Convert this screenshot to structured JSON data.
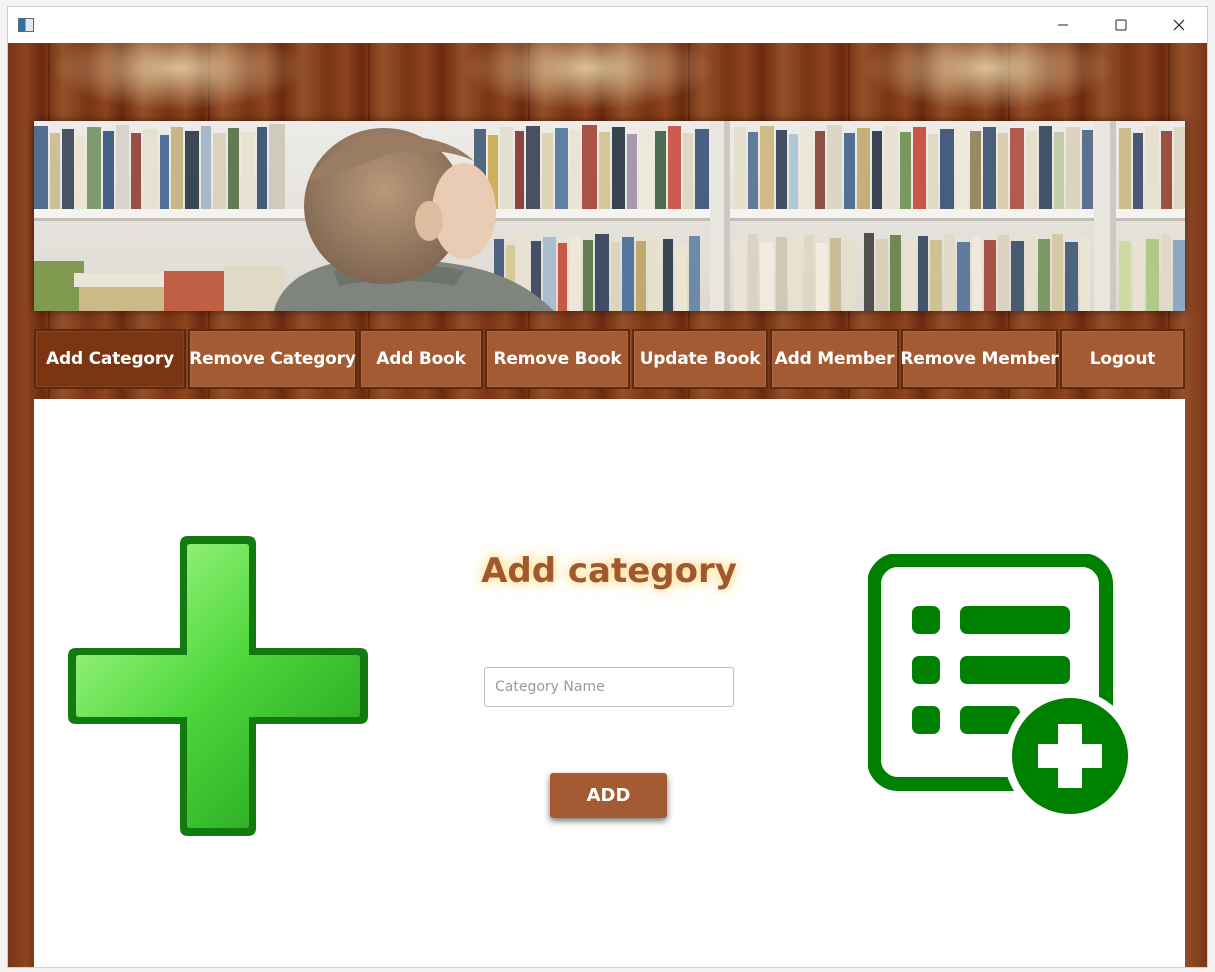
{
  "window": {
    "minimize_icon": "minimize-icon",
    "maximize_icon": "maximize-icon",
    "close_icon": "close-icon"
  },
  "nav": {
    "items": [
      {
        "label": "Add Category",
        "active": true
      },
      {
        "label": "Remove Category",
        "active": false
      },
      {
        "label": "Add Book",
        "active": false
      },
      {
        "label": "Remove Book",
        "active": false
      },
      {
        "label": "Update Book",
        "active": false
      },
      {
        "label": "Add Member",
        "active": false
      },
      {
        "label": "Remove Member",
        "active": false
      },
      {
        "label": "Logout",
        "active": false
      }
    ]
  },
  "main": {
    "heading": "Add category",
    "category_input": {
      "value": "",
      "placeholder": "Category Name"
    },
    "add_label": "ADD"
  },
  "colors": {
    "button_brown": "#a45a33",
    "active_brown": "#7b3512",
    "icon_green": "#008000"
  }
}
